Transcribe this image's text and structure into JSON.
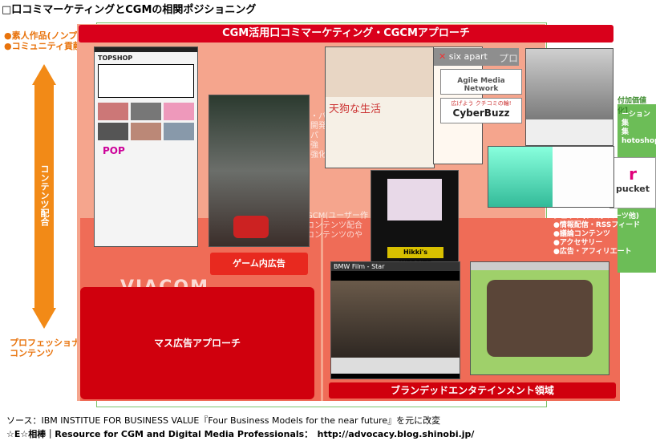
{
  "title": "□口コミマーケティングとCGMの相関ポジショニング",
  "header_band": "CGM活用口コミマーケティング・CGCMアプローチ",
  "left_axis": {
    "top_labels": [
      "●素人作品(ノンプ",
      "●コミュニティ貢献"
    ],
    "vertical_label": "コンテンツ配合",
    "bottom_labels": [
      "プロフェッショナ",
      "コンテンツ"
    ]
  },
  "right_panel": {
    "label_top": "付加価値化】",
    "lines": [
      "ーション",
      "集",
      "集",
      "hotoshop)"
    ],
    "widget_title": "ジェット(ブログパーツ他)",
    "widget_items": [
      "●情報配信・RSSフィード",
      "●議論コンテンツ",
      "●アクセサリー",
      "●広告・アフィリエート"
    ]
  },
  "boxes": {
    "game_ad": "ゲーム内広告",
    "mass_ad": "マス広告アプローチ",
    "branded": "ブランデッドエンタテインメント領域"
  },
  "screens": {
    "topshop": "TOPSHOP",
    "pop": "POP",
    "six_apart": "six apart",
    "six_apart_suffix": "プロ",
    "agile": "Agile Media Network",
    "cyberbuzz_tag": "広げよう クチコミの輪!",
    "cyberbuzz": "CyberBuzz",
    "blog_title": "天狗な生活",
    "hikki": "Hikki's WEBSITE",
    "bmw": "BMW Film - Star",
    "pucket": "pucket",
    "viacom": "VIACOM"
  },
  "mid_faded": [
    "・パ",
    "開発",
    "パ",
    "強",
    "強化"
  ],
  "mid_faded_lower": [
    "GCM(ユーザー作",
    "コンテンツ配合",
    "コンテンツのや"
  ],
  "footer": {
    "source": "ソース：IBM INSTITUE FOR BUSINESS VALUE『Four Business Models for the near future』を元に改変",
    "credit": "☆E☆相棒｜Resource for CGM and Digital Media Professionals：　http://advocacy.blog.shinobi.jp/"
  },
  "colors": {
    "accent_red": "#d0000d",
    "pink": "#f5a58d",
    "salmon": "#ef6c57",
    "orange": "#f28a17",
    "green": "#6cbd57"
  }
}
